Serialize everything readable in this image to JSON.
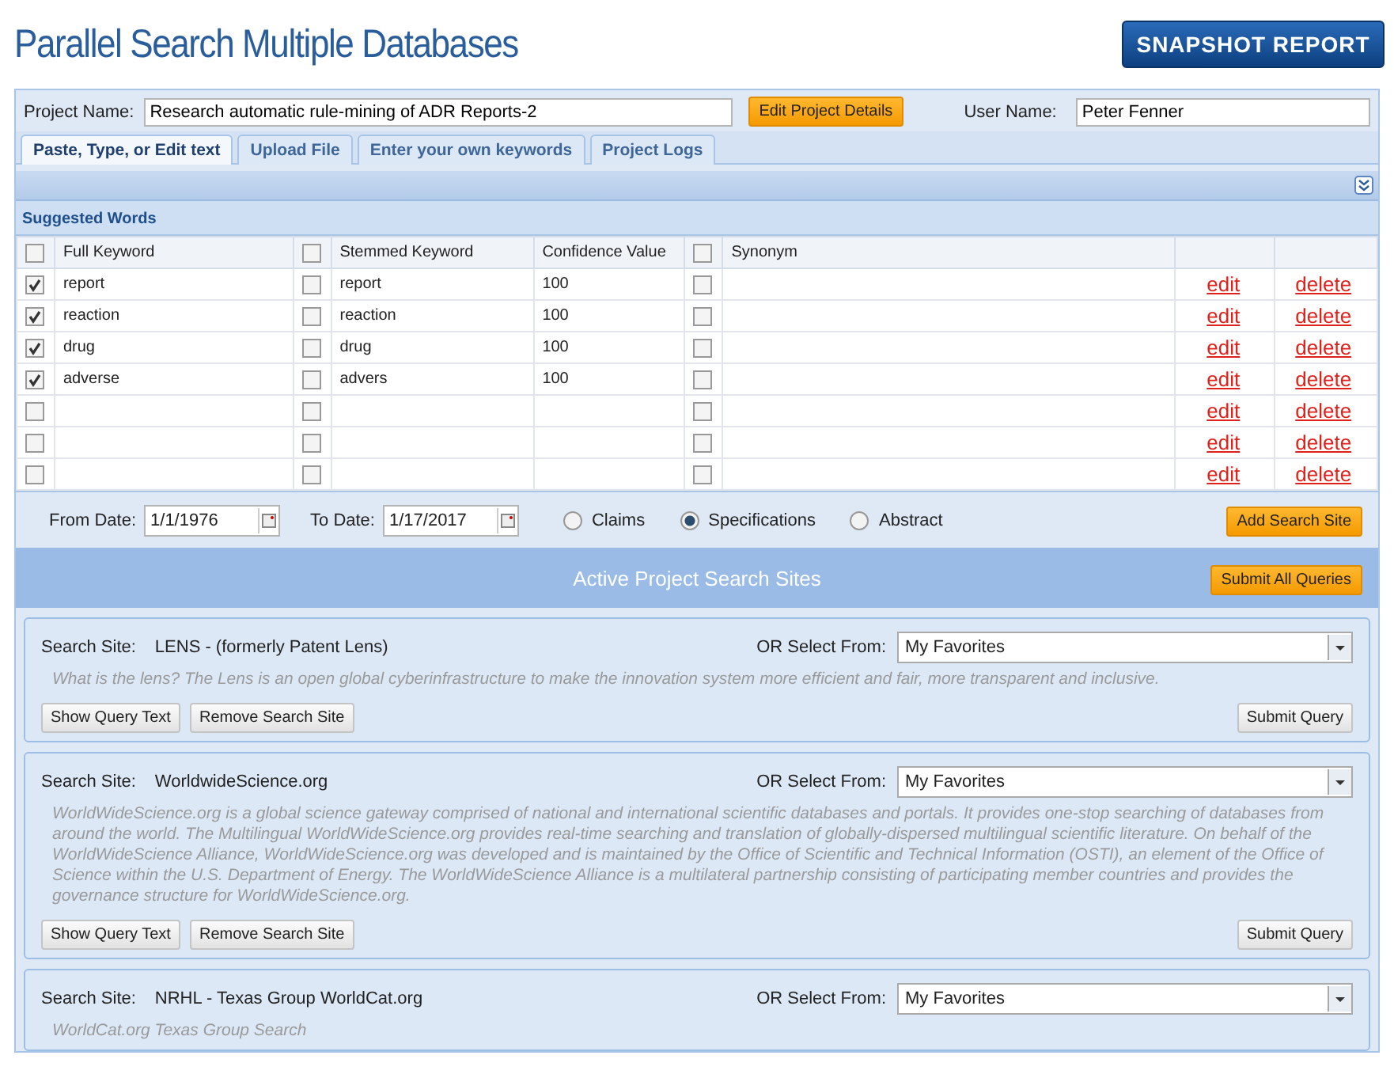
{
  "title": "Parallel Search Multiple Databases",
  "snapshot_button": "SNAPSHOT REPORT",
  "project": {
    "name_label": "Project Name:",
    "name_value": "Research automatic rule-mining of ADR Reports-2",
    "edit_button": "Edit Project Details",
    "user_label": "User Name:",
    "user_value": "Peter Fenner"
  },
  "tabs": [
    {
      "label": "Paste, Type, or Edit text",
      "selected": true
    },
    {
      "label": "Upload File",
      "selected": false
    },
    {
      "label": "Enter your own keywords",
      "selected": false
    },
    {
      "label": "Project Logs",
      "selected": false
    }
  ],
  "suggested_words": {
    "title": "Suggested Words",
    "columns": [
      {
        "kind": "check",
        "checked": false
      },
      {
        "kind": "text",
        "label": "Full Keyword"
      },
      {
        "kind": "check",
        "checked": false
      },
      {
        "kind": "text",
        "label": "Stemmed Keyword"
      },
      {
        "kind": "text",
        "label": "Confidence Value"
      },
      {
        "kind": "check",
        "checked": false
      },
      {
        "kind": "text",
        "label": "Synonym"
      },
      {
        "kind": "blank"
      },
      {
        "kind": "blank"
      }
    ],
    "rows": [
      {
        "full_checked": true,
        "full": "report",
        "stem_checked": false,
        "stem": "report",
        "confidence": "100",
        "syn_checked": false,
        "edit": "edit",
        "delete": "delete"
      },
      {
        "full_checked": true,
        "full": "reaction",
        "stem_checked": false,
        "stem": "reaction",
        "confidence": "100",
        "syn_checked": false,
        "edit": "edit",
        "delete": "delete"
      },
      {
        "full_checked": true,
        "full": "drug",
        "stem_checked": false,
        "stem": "drug",
        "confidence": "100",
        "syn_checked": false,
        "edit": "edit",
        "delete": "delete"
      },
      {
        "full_checked": true,
        "full": "adverse",
        "stem_checked": false,
        "stem": "advers",
        "confidence": "100",
        "syn_checked": false,
        "edit": "edit",
        "delete": "delete"
      },
      {
        "full_checked": false,
        "stem_checked": false,
        "syn_checked": false,
        "edit": "edit",
        "delete": "delete"
      },
      {
        "full_checked": false,
        "stem_checked": false,
        "syn_checked": false,
        "edit": "edit",
        "delete": "delete"
      },
      {
        "full_checked": false,
        "stem_checked": false,
        "syn_checked": false,
        "edit": "edit",
        "delete": "delete"
      }
    ]
  },
  "dates": {
    "from_label": "From Date:",
    "from_value": "1/1/1976",
    "to_label": "To Date:",
    "to_value": "1/17/2017"
  },
  "radios": [
    {
      "label": "Claims",
      "selected": false
    },
    {
      "label": "Specifications",
      "selected": true
    },
    {
      "label": "Abstract",
      "selected": false
    }
  ],
  "add_site_button": "Add Search Site",
  "active_sites": {
    "title": "Active Project Search Sites",
    "submit_all_button": "Submit All Queries"
  },
  "sites": [
    {
      "label": "Search Site:",
      "name": "LENS - (formerly Patent Lens)",
      "select_label": "OR Select From:",
      "select_value": "My Favorites",
      "description": "What is the lens? The Lens is an open global cyberinfrastructure to make the innovation system more efficient and fair, more transparent and inclusive.",
      "buttons": [
        "Show Query Text",
        "Remove Search Site"
      ],
      "submit_button": "Submit Query"
    },
    {
      "label": "Search Site:",
      "name": "WorldwideScience.org",
      "select_label": "OR Select From:",
      "select_value": "My Favorites",
      "description": "WorldWideScience.org is a global science gateway comprised of national and international scientific databases and portals. It provides one-stop searching of databases from around the world. The Multilingual WorldWideScience.org provides real-time searching and translation of globally-dispersed multilingual scientific literature. On behalf of the WorldWideScience Alliance, WorldWideScience.org was developed and is maintained by the Office of Scientific and Technical Information (OSTI), an element of the Office of Science within the U.S. Department of Energy. The WorldWideScience Alliance is a multilateral partnership consisting of participating member countries and provides the governance structure for WorldWideScience.org.",
      "buttons": [
        "Show Query Text",
        "Remove Search Site"
      ],
      "submit_button": "Submit Query"
    },
    {
      "label": "Search Site:",
      "name": "NRHL - Texas Group WorldCat.org",
      "select_label": "OR Select From:",
      "select_value": "My Favorites",
      "description": "WorldCat.org Texas Group Search"
    }
  ]
}
